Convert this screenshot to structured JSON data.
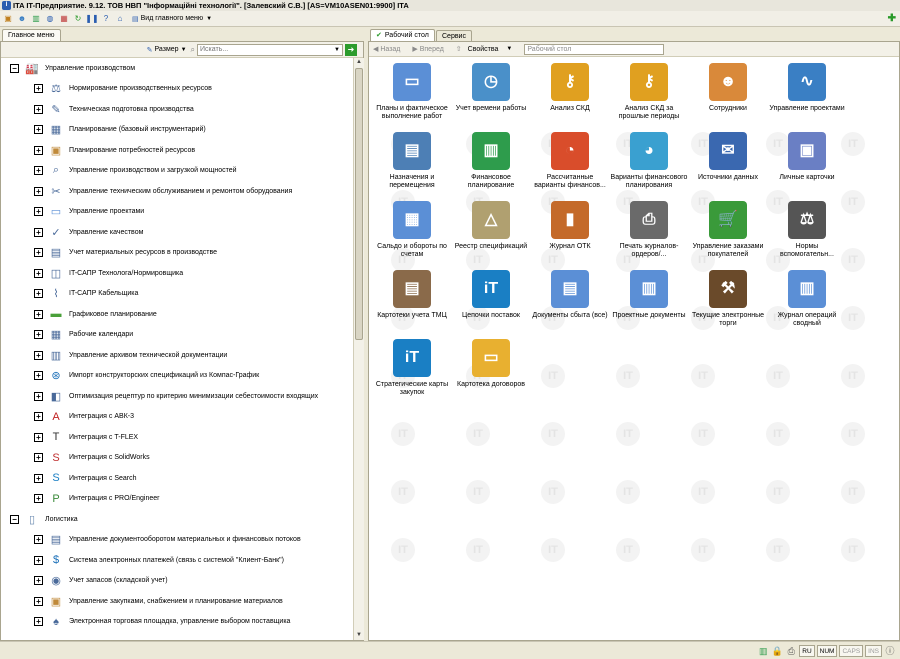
{
  "window": {
    "title": "ITA IT-Предприятие. 9.12. ТОВ НВП \"Інформаційні технології\". [Залевский С.В.] [AS=VM10ASEN01:9900] ITA"
  },
  "toolbar": {
    "menu_label": "Вид главного меню"
  },
  "left": {
    "tab_label": "Главное меню",
    "size_button": "Размер",
    "search_placeholder": "Искать...",
    "tree": [
      {
        "level": 0,
        "expanded": true,
        "icon": "factory-icon",
        "label": "Управление производством"
      },
      {
        "level": 1,
        "icon": "scales-icon",
        "label": "Нормирование производственных ресурсов"
      },
      {
        "level": 1,
        "icon": "drawing-icon",
        "label": "Техническая подготовка производства"
      },
      {
        "level": 1,
        "icon": "calendar-plan-icon",
        "label": "Планирование (базовый инструментарий)"
      },
      {
        "level": 1,
        "icon": "box-icon",
        "label": "Планирование потребностей ресурсов"
      },
      {
        "level": 1,
        "icon": "magnifier-icon",
        "label": "Управление производством и загрузкой мощностей"
      },
      {
        "level": 1,
        "icon": "tools-icon",
        "label": "Управление техническим обслуживанием и ремонтом оборудования"
      },
      {
        "level": 1,
        "icon": "folder-icon",
        "label": "Управление проектами"
      },
      {
        "level": 1,
        "icon": "quality-icon",
        "label": "Управление качеством"
      },
      {
        "level": 1,
        "icon": "materials-icon",
        "label": "Учет материальных ресурсов в производстве"
      },
      {
        "level": 1,
        "icon": "cad-icon",
        "label": "IT-САПР Технолога/Нормировщика"
      },
      {
        "level": 1,
        "icon": "cable-icon",
        "label": "IT-САПР Кабельщика"
      },
      {
        "level": 1,
        "icon": "gantt-icon",
        "label": "Графиковое планирование"
      },
      {
        "level": 1,
        "icon": "calendar-icon",
        "label": "Рабочие календари"
      },
      {
        "level": 1,
        "icon": "archive-icon",
        "label": "Управление архивом технической документации"
      },
      {
        "level": 1,
        "icon": "import-icon",
        "label": "Импорт конструкторских спецификаций из Компас-График"
      },
      {
        "level": 1,
        "icon": "optimize-icon",
        "label": "Оптимизация рецептур по критерию минимизации себестоимости входящих"
      },
      {
        "level": 1,
        "icon": "abk-icon",
        "label": "Интеграция с АВК-3"
      },
      {
        "level": 1,
        "icon": "tflex-icon",
        "label": "Интеграция с T-FLEX"
      },
      {
        "level": 1,
        "icon": "solidworks-icon",
        "label": "Интеграция с SolidWorks"
      },
      {
        "level": 1,
        "icon": "search-s-icon",
        "label": "Интеграция с Search"
      },
      {
        "level": 1,
        "icon": "proengineer-icon",
        "label": "Интеграция с PRO/Engineer"
      },
      {
        "level": 0,
        "expanded": true,
        "icon": "logistics-icon",
        "label": "Логистика"
      },
      {
        "level": 1,
        "icon": "docflow-icon",
        "label": "Управление документооборотом материальных и финансовых потоков"
      },
      {
        "level": 1,
        "icon": "dollar-icon",
        "label": "Система электронных платежей (связь с системой \"Клиент-Банк\")"
      },
      {
        "level": 1,
        "icon": "stock-icon",
        "label": "Учет запасов (складской учет)"
      },
      {
        "level": 1,
        "icon": "purchase-icon",
        "label": "Управление закупками, снабжением и планирование материалов"
      },
      {
        "level": 1,
        "icon": "trade-icon",
        "label": "Электронная торговая площадка, управление выбором поставщика"
      }
    ]
  },
  "right": {
    "tab_desktop": "Рабочий стол",
    "tab_service": "Сервис",
    "back": "Назад",
    "forward": "Вперед",
    "properties": "Свойства",
    "address": "Рабочий стол",
    "items": [
      {
        "label": "Планы и фактическое выполнение работ",
        "icon": "folder-blue-icon",
        "color": "#5b8fd6"
      },
      {
        "label": "Учет времени работы",
        "icon": "clock-icon",
        "color": "#4a90c9"
      },
      {
        "label": "Анализ СКД",
        "icon": "key-icon",
        "color": "#e0a020"
      },
      {
        "label": "Анализ СКД за прошлые периоды",
        "icon": "key-icon",
        "color": "#e0a020"
      },
      {
        "label": "Сотрудники",
        "icon": "people-icon",
        "color": "#d9893a"
      },
      {
        "label": "Управление проектами",
        "icon": "chart-wave-icon",
        "color": "#3a7fc4"
      },
      {
        "label": "Назначения и перемещения",
        "icon": "cabinet-icon",
        "color": "#4d7fb5"
      },
      {
        "label": "Финансовое планирование",
        "icon": "bars-color-icon",
        "color": "#2e9c4c"
      },
      {
        "label": "Рассчитанные варианты финансов...",
        "icon": "pie-doc-icon",
        "color": "#d94d2b"
      },
      {
        "label": "Варианты финансового планирования",
        "icon": "pie-3d-icon",
        "color": "#3aa0d0"
      },
      {
        "label": "Источники данных",
        "icon": "mailbox-icon",
        "color": "#3a68b0"
      },
      {
        "label": "Личные карточки",
        "icon": "id-card-icon",
        "color": "#6a7fc4"
      },
      {
        "label": "Сальдо и обороты по счетам",
        "icon": "calculator-icon",
        "color": "#5b8fd6"
      },
      {
        "label": "Реестр спецификаций",
        "icon": "drafting-icon",
        "color": "#b0a070"
      },
      {
        "label": "Журнал ОТК",
        "icon": "journal-icon",
        "color": "#c46a2a"
      },
      {
        "label": "Печать журналов-ордеров/...",
        "icon": "printer-icon",
        "color": "#6a6a6a"
      },
      {
        "label": "Управление заказами покупателей",
        "icon": "cart-icon",
        "color": "#3a9a3a"
      },
      {
        "label": "Нормы вспомогательн...",
        "icon": "scales-icon",
        "color": "#555555"
      },
      {
        "label": "Картотеки учета ТМЦ",
        "icon": "card-box-icon",
        "color": "#8a6a4a"
      },
      {
        "label": "Цепочки поставок",
        "icon": "it-logo-icon",
        "color": "#1a7fc4"
      },
      {
        "label": "Документы сбыта (все)",
        "icon": "docs-icon",
        "color": "#5b8fd6"
      },
      {
        "label": "Проектные документы",
        "icon": "docs-chart-icon",
        "color": "#5b8fd6"
      },
      {
        "label": "Текущие электронные торги",
        "icon": "gavel-icon",
        "color": "#6a4a2a"
      },
      {
        "label": "Журнал операций сводный",
        "icon": "folder-chart-icon",
        "color": "#5b8fd6"
      },
      {
        "label": "Стратегические карты закупок",
        "icon": "it-logo-icon",
        "color": "#1a7fc4"
      },
      {
        "label": "Картотека договоров",
        "icon": "folder-yellow-icon",
        "color": "#e8b030"
      }
    ]
  },
  "status": {
    "lang": "RU",
    "num": "NUM",
    "caps": "CAPS",
    "ins": "INS"
  }
}
